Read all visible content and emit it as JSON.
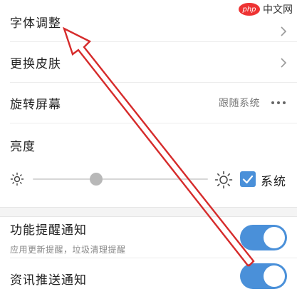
{
  "watermark": {
    "logo_text": "php",
    "site_text": "中文网"
  },
  "settings": {
    "font_adjust": {
      "label": "字体调整"
    },
    "change_skin": {
      "label": "更换皮肤"
    },
    "rotate_screen": {
      "label": "旋转屏幕",
      "value": "跟随系统"
    },
    "brightness": {
      "label": "亮度",
      "level_percent": 36,
      "follow_system_label": "系统",
      "follow_system_checked": true
    },
    "notifications": {
      "feature_reminder": {
        "label": "功能提醒通知",
        "description": "应用更新提醒，垃圾清理提醒",
        "enabled": true
      },
      "news_push": {
        "label": "资讯推送通知",
        "enabled": true
      }
    }
  },
  "colors": {
    "accent": "#4a90d9",
    "annotation_arrow": "#d62b2b"
  },
  "icons": {
    "chevron": "chevron-right-icon",
    "more": "more-dots-icon",
    "brightness_low": "sun-small-icon",
    "brightness_high": "sun-large-icon",
    "checkbox": "checkbox-checked-icon"
  }
}
